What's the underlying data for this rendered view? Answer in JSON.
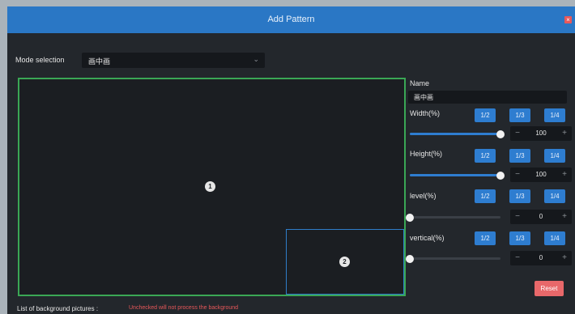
{
  "dialog": {
    "title": "Add Pattern",
    "close_glyph": "×"
  },
  "mode": {
    "label": "Mode selection",
    "value": "画中画",
    "chevron": "⌄"
  },
  "canvas": {
    "zones": [
      {
        "number": "1"
      },
      {
        "number": "2"
      }
    ]
  },
  "panel": {
    "name_label": "Name",
    "name_value": "画中画",
    "fraction_buttons": [
      "1/2",
      "1/3",
      "1/4"
    ],
    "width": {
      "label": "Width(%)",
      "value": "100",
      "level": 1.0
    },
    "height": {
      "label": "Height(%)",
      "value": "100",
      "level": 1.0
    },
    "level": {
      "label": "level(%)",
      "value": "0",
      "level": 0.0
    },
    "vertical": {
      "label": "vertical(%)",
      "value": "0",
      "level": 0.0
    },
    "minus": "−",
    "plus": "+",
    "reset_label": "Reset"
  },
  "background": {
    "label": "List of background pictures :",
    "note": "Unchecked will not process the background"
  },
  "colors": {
    "title_bar": "#2a77c5",
    "panel_bg": "#23272c",
    "zone1_border": "#3aa755",
    "zone2_border": "#2f7ec9",
    "button_blue": "#2e7dd0",
    "reset_red": "#e8686a",
    "note_red": "#e8585a"
  }
}
